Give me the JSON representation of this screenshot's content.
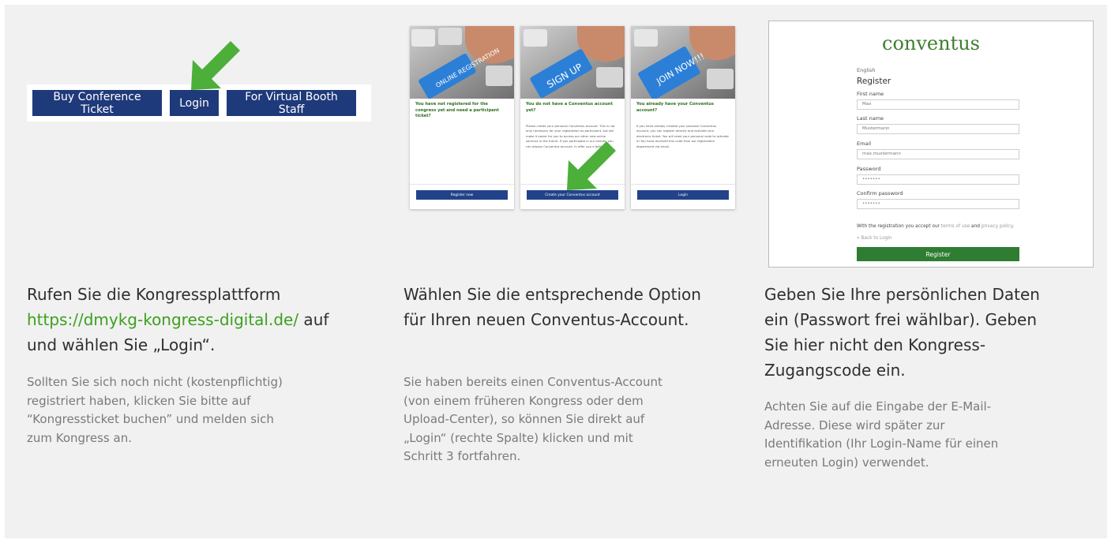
{
  "col1": {
    "buttons": {
      "buy": "Buy Conference Ticket",
      "login": "Login",
      "booth": "For Virtual Booth Staff"
    },
    "heading": {
      "line1": "Rufen Sie die Kongressplattform",
      "url": "https://dmykg-kongress-digital.de/",
      "after_url": " auf",
      "line3": "und wählen Sie „Login“."
    },
    "desc": [
      "Sollten Sie sich noch nicht (kostenpflichtig)",
      "registriert haben, klicken Sie bitte auf",
      "“Kongressticket buchen” und melden sich",
      "zum Kongress an."
    ]
  },
  "col2": {
    "cards": [
      {
        "photo_label": "ONLINE REGISTRATION",
        "title": "You have not registered for the congress yet and need a participant ticket?",
        "text": "",
        "button": "Register now"
      },
      {
        "photo_label": "SIGN UP",
        "title": "You do not have a Conventus account yet?",
        "text": "Please create your personal Conventus account. This is not only necessary for your registration as participant, but will make it easier for you to access our other new online services in the future. If you participate in our events, you can always Conventus account. In offer you a better",
        "button": "Create your Conventus account"
      },
      {
        "photo_label": "JOIN NOW!!!",
        "title": "You already have your Conventus account?",
        "text": "If you have already created your personal Conventus account, you can register directly and activate your electronic ticket. You will need your personal code to activate it! You have received this code from our registration department via email.",
        "button": "Login"
      }
    ],
    "heading": [
      "Wählen Sie die entsprechende Option",
      "für Ihren neuen Conventus-Account."
    ],
    "desc": [
      "Sie haben bereits einen Conventus-Account",
      "(von einem früheren Kongress oder dem",
      "Upload-Center), so können Sie direkt auf",
      "„Login“ (rechte Spalte) klicken und mit",
      "Schritt 3 fortfahren."
    ]
  },
  "col3": {
    "form": {
      "logo": "conventus",
      "lang": "English",
      "title": "Register",
      "first_name_label": "First name",
      "first_name_value": "Max",
      "last_name_label": "Last name",
      "last_name_value": "Mustermann",
      "email_label": "Email",
      "email_value": "max.mustermann",
      "password_label": "Password",
      "password_value": "•••••••",
      "confirm_label": "Confirm password",
      "confirm_value": "•••••••",
      "terms_prefix": "With the registration you accept our ",
      "terms_link": "terms of use",
      "terms_and": " and ",
      "privacy_link": "privacy policy",
      "terms_suffix": ".",
      "back": "« Back to Login",
      "register_button": "Register"
    },
    "heading": [
      "Geben Sie Ihre persönlichen Daten",
      "ein (Passwort frei wählbar). Geben",
      "Sie hier nicht den Kongress-",
      "Zugangscode ein."
    ],
    "desc": [
      "Achten Sie auf die Eingabe der E-Mail-",
      "Adresse. Diese wird später zur",
      "Identifikation (Ihr Login-Name für einen",
      "erneuten Login) verwendet."
    ]
  },
  "colors": {
    "background": "#f1f1f1",
    "button_blue": "#1f3a7a",
    "arrow_green": "#4caf3a",
    "link_green": "#3da01f",
    "register_green": "#2e7d32",
    "heading_text": "#2f2f2f",
    "desc_text": "#7a7a7a"
  }
}
